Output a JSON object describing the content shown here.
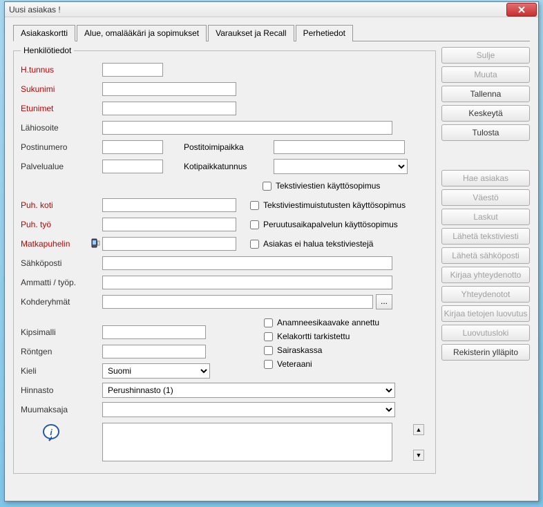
{
  "title": "Uusi asiakas !",
  "tabs": [
    "Asiakaskortti",
    "Alue, omalääkäri ja sopimukset",
    "Varaukset ja Recall",
    "Perhetiedot"
  ],
  "fieldset_legend": "Henkilötiedot",
  "labels": {
    "htunnus": "H.tunnus",
    "sukunimi": "Sukunimi",
    "etunimet": "Etunimet",
    "lahiosoite": "Lähiosoite",
    "postinumero": "Postinumero",
    "postitoimipaikka": "Postitoimipaikka",
    "palvelualue": "Palvelualue",
    "kotipaikkatunnus": "Kotipaikkatunnus",
    "puh_koti": "Puh. koti",
    "puh_tyo": "Puh. työ",
    "matkapuhelin": "Matkapuhelin",
    "sahkoposti": "Sähköposti",
    "ammatti": "Ammatti / työp.",
    "kohderyhmat": "Kohderyhmät",
    "kipsimalli": "Kipsimalli",
    "rontgen": "Röntgen",
    "kieli": "Kieli",
    "hinnasto": "Hinnasto",
    "muumaksaja": "Muumaksaja"
  },
  "values": {
    "kieli": "Suomi",
    "hinnasto": "Perushinnasto (1)"
  },
  "checks1": [
    "Tekstiviestien käyttösopimus",
    "Tekstiviestimuistutusten käyttösopimus",
    "Peruutusaikapalvelun käyttösopimus",
    "Asiakas ei halua tekstiviestejä"
  ],
  "checks2": [
    "Anamneesikaavake annettu",
    "Kelakortti tarkistettu",
    "Sairaskassa",
    "Veteraani"
  ],
  "dots": "...",
  "sidebar": {
    "sulje": "Sulje",
    "muuta": "Muuta",
    "tallenna": "Tallenna",
    "keskeyta": "Keskeytä",
    "tulosta": "Tulosta",
    "hae_asiakas": "Hae asiakas",
    "vaesto": "Väestö",
    "laskut": "Laskut",
    "laheta_tv": "Lähetä tekstiviesti",
    "laheta_sp": "Lähetä sähköposti",
    "kirjaa_yht": "Kirjaa yhteydenotto",
    "yhteydenotot": "Yhteydenotot",
    "kirjaa_luov": "Kirjaa tietojen luovutus",
    "luovutusloki": "Luovutusloki",
    "rekisterin": "Rekisterin ylläpito"
  }
}
